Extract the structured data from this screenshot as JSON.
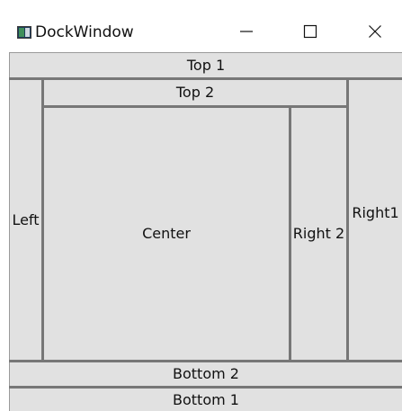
{
  "window": {
    "title": "DockWindow",
    "icon": "window-app-icon",
    "controls": {
      "minimize_icon": "minimize-icon",
      "maximize_icon": "maximize-icon",
      "close_icon": "close-icon"
    }
  },
  "dock_panel": {
    "top1": "Top 1",
    "left": "Left",
    "top2": "Top 2",
    "center": "Center",
    "right2": "Right 2",
    "right1": "Right1",
    "bottom2": "Bottom 2",
    "bottom1": "Bottom 1"
  },
  "colors": {
    "panel_background": "#e1e1e1",
    "border": "#777777",
    "window_background": "#ffffff"
  }
}
